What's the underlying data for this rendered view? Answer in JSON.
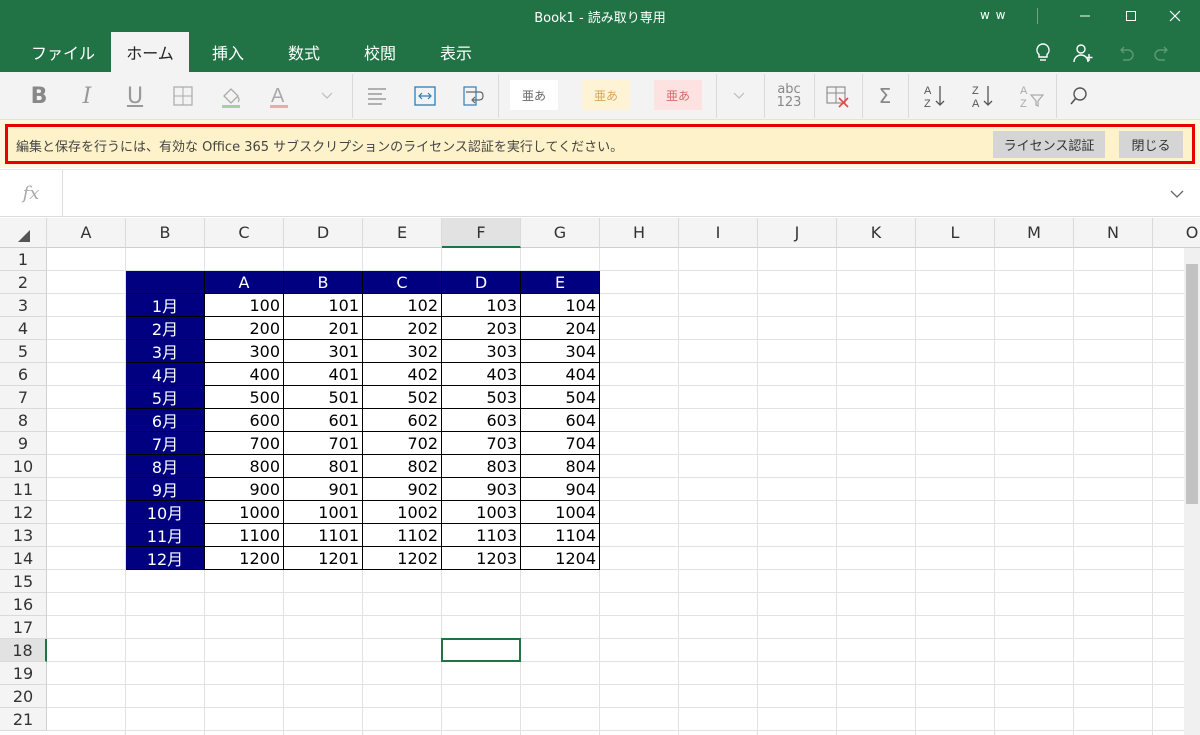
{
  "window": {
    "title": "Book1 - 読み取り専用",
    "user": "w w"
  },
  "tabs": [
    "ファイル",
    "ホーム",
    "挿入",
    "数式",
    "校閲",
    "表示"
  ],
  "active_tab": "ホーム",
  "ribbon": {
    "style_chips": [
      "亜あ",
      "亜あ",
      "亜あ"
    ],
    "number_format": "abc\n123",
    "number_format_top": "abc",
    "number_format_bottom": "123"
  },
  "message_bar": {
    "text": "編集と保存を行うには、有効な Office 365 サブスクリプションのライセンス認証を実行してください。",
    "license_button": "ライセンス認証",
    "close_button": "閉じる"
  },
  "formula_bar": {
    "fx_label": "fx",
    "value": ""
  },
  "columns": [
    "A",
    "B",
    "C",
    "D",
    "E",
    "F",
    "G",
    "H",
    "I",
    "J",
    "K",
    "L",
    "M",
    "N",
    "O"
  ],
  "rows": [
    "1",
    "2",
    "3",
    "4",
    "5",
    "6",
    "7",
    "8",
    "9",
    "10",
    "11",
    "12",
    "13",
    "14",
    "15",
    "16",
    "17",
    "18",
    "19",
    "20",
    "21"
  ],
  "selected_cell": "F18",
  "table": {
    "headers": [
      "A",
      "B",
      "C",
      "D",
      "E"
    ],
    "months": [
      "1月",
      "2月",
      "3月",
      "4月",
      "5月",
      "6月",
      "7月",
      "8月",
      "9月",
      "10月",
      "11月",
      "12月"
    ],
    "values": [
      [
        "100",
        "101",
        "102",
        "103",
        "104"
      ],
      [
        "200",
        "201",
        "202",
        "203",
        "204"
      ],
      [
        "300",
        "301",
        "302",
        "303",
        "304"
      ],
      [
        "400",
        "401",
        "402",
        "403",
        "404"
      ],
      [
        "500",
        "501",
        "502",
        "503",
        "504"
      ],
      [
        "600",
        "601",
        "602",
        "603",
        "604"
      ],
      [
        "700",
        "701",
        "702",
        "703",
        "704"
      ],
      [
        "800",
        "801",
        "802",
        "803",
        "804"
      ],
      [
        "900",
        "901",
        "902",
        "903",
        "904"
      ],
      [
        "1000",
        "1001",
        "1002",
        "1003",
        "1004"
      ],
      [
        "1100",
        "1101",
        "1102",
        "1103",
        "1104"
      ],
      [
        "1200",
        "1201",
        "1202",
        "1203",
        "1204"
      ]
    ]
  },
  "colors": {
    "brand_green": "#217346",
    "table_header_fill": "#000080",
    "message_bar_fill": "#fdf2c9",
    "highlight_border": "#e60000"
  }
}
